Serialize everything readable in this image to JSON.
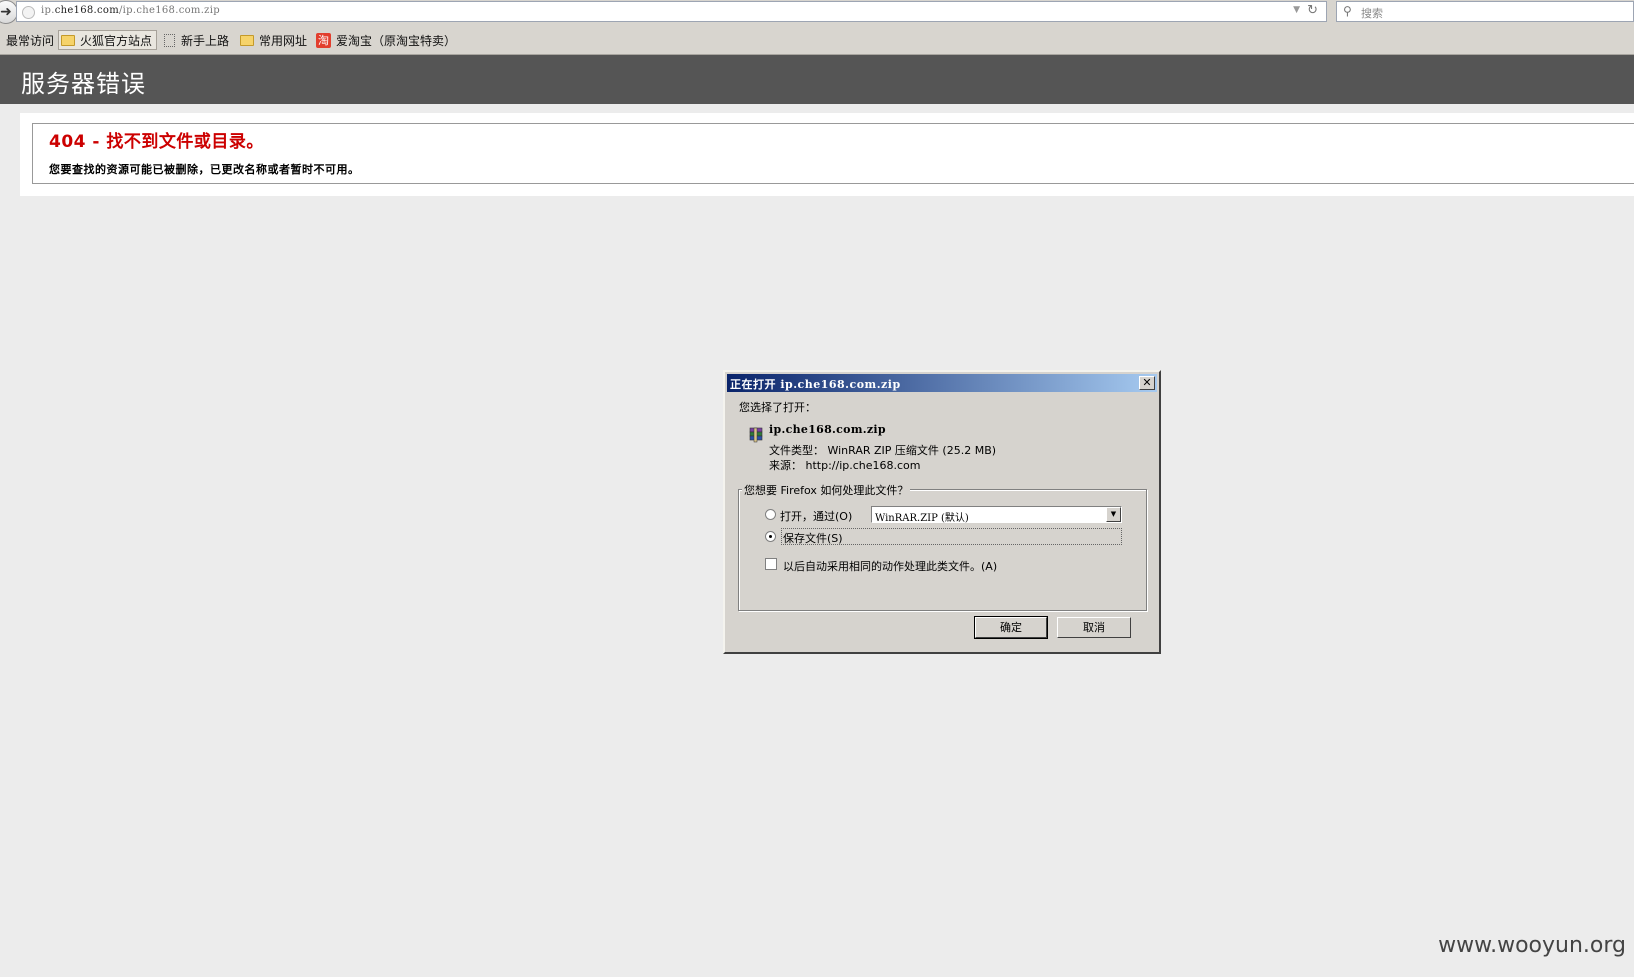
{
  "browser": {
    "url_prefix": "ip.",
    "url_host": "che168.com",
    "url_path": "/ip.che168.com.zip",
    "search_placeholder": "搜索",
    "bookmarks": [
      "最常访问",
      "火狐官方站点",
      "新手上路",
      "常用网址",
      "爱淘宝（原淘宝特卖）"
    ],
    "taobao_glyph": "淘"
  },
  "page": {
    "header_title": "服务器错误",
    "error_title": "404 - 找不到文件或目录。",
    "error_desc": "您要查找的资源可能已被删除，已更改名称或者暂时不可用。"
  },
  "dialog": {
    "title": "正在打开 ip.che168.com.zip",
    "chosen_label": "您选择了打开：",
    "file_name": "ip.che168.com.zip",
    "file_type_line": "文件类型： WinRAR ZIP 压缩文件 (25.2 MB)",
    "source_line": "来源： http://ip.che168.com",
    "group_label": "您想要 Firefox 如何处理此文件？",
    "open_with_label": "打开，通过(O)",
    "open_with_value": "WinRAR.ZIP (默认)",
    "save_label": "保存文件(S)",
    "auto_label": "以后自动采用相同的动作处理此类文件。(A)",
    "ok_label": "确定",
    "cancel_label": "取消",
    "selected_action": "save",
    "auto_checked": false
  },
  "watermark": "www.wooyun.org",
  "colors": {
    "header_bg": "#555555",
    "error_red": "#cc0000",
    "titlebar_start": "#0a246a",
    "titlebar_end": "#a6caf0"
  }
}
